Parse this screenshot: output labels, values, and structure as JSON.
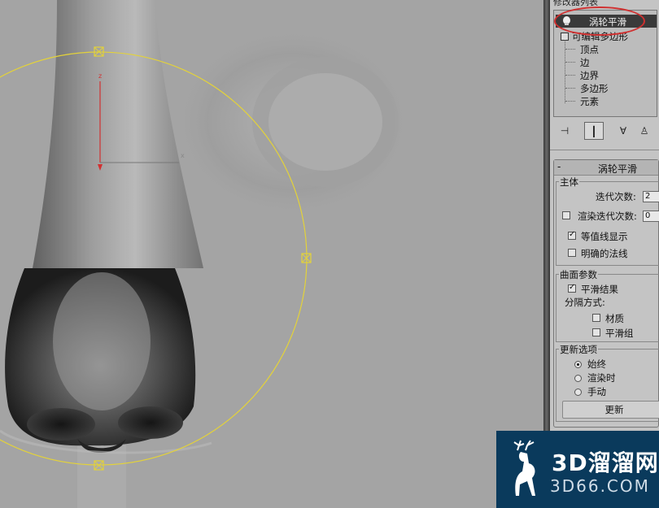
{
  "viewport": {
    "gizmo_axis_label": "z",
    "gizmo_axis_label_x": "x"
  },
  "panel": {
    "stack_title": "修改器列表",
    "stack": {
      "selected_modifier": "涡轮平滑",
      "base_object": "可编辑多边形",
      "sub_objects": [
        "顶点",
        "边",
        "边界",
        "多边形",
        "元素"
      ]
    },
    "toolbar": [
      "pin-stack-icon",
      "show-end-result-icon",
      "make-unique-icon",
      "remove-modifier-icon"
    ],
    "rollout": {
      "collapse": "-",
      "title": "涡轮平滑",
      "main_group": "主体",
      "iterations_label": "迭代次数:",
      "iterations_value": "2",
      "render_iters_label": "渲染迭代次数:",
      "render_iters_value": "0",
      "isoline_label": "等值线显示",
      "explicit_normals_label": "明确的法线",
      "surface_group": "曲面参数",
      "smooth_result_label": "平滑结果",
      "separate_by_label": "分隔方式:",
      "materials_label": "材质",
      "smoothing_groups_label": "平滑组",
      "update_group": "更新选项",
      "always_label": "始终",
      "when_rendering_label": "渲染时",
      "manually_label": "手动",
      "update_button": "更新"
    }
  },
  "watermark": {
    "cn": "3D溜溜网",
    "en": "3D66.COM"
  },
  "colors": {
    "selection_circle": "#d03030",
    "gizmo": "#e3d23a",
    "watermark_bg": "#0a3a5c"
  }
}
